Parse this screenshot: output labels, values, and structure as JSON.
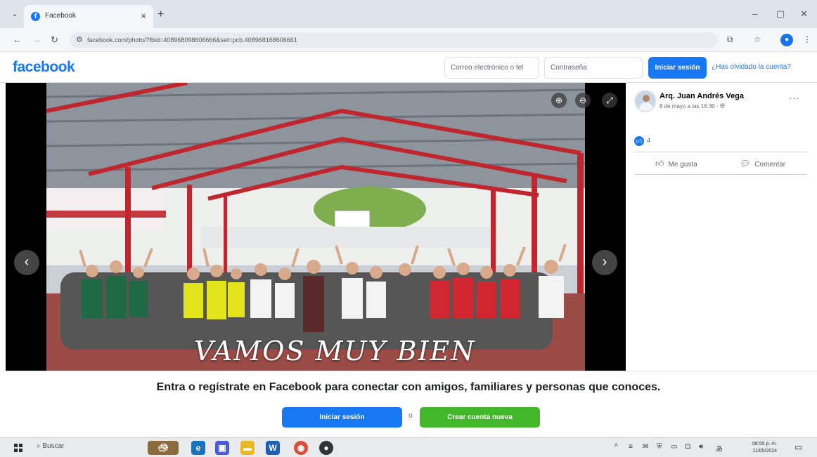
{
  "browser": {
    "tab_title": "Facebook",
    "tab_close": "×",
    "new_tab": "+",
    "url": "facebook.com/photo/?fbid=408968098606666&set=pcb.408968168606661",
    "window_controls": [
      "–",
      "▢",
      "✕"
    ]
  },
  "header": {
    "logo": "facebook",
    "email_placeholder": "Correo electrónico o tel",
    "password_placeholder": "Contraseña",
    "login_label": "Iniciar sesión",
    "forgot_label": "¿Has olvidado la cuenta?"
  },
  "photo": {
    "caption": "VAMOS MUY  BIEN",
    "prev_icon": "‹",
    "next_icon": "›"
  },
  "post": {
    "author": "Arq. Juan Andrés Vega",
    "meta": "8 de mayo a las 16:30 ·",
    "more": "···",
    "like_count": "4",
    "like_label": "Me gusta",
    "comment_label": "Comentar"
  },
  "banner": {
    "text": "Entra o regístrate en Facebook para conectar con amigos, familiares y personas que conoces.",
    "login_label": "Iniciar sesión",
    "separator": "o",
    "create_label": "Crear cuenta nueva"
  },
  "taskbar": {
    "search_label": "Buscar",
    "clock_time": "06:55 p. m.",
    "clock_date": "11/05/2024"
  },
  "colors": {
    "facebook_blue": "#1877f2",
    "create_green": "#42b72a"
  }
}
